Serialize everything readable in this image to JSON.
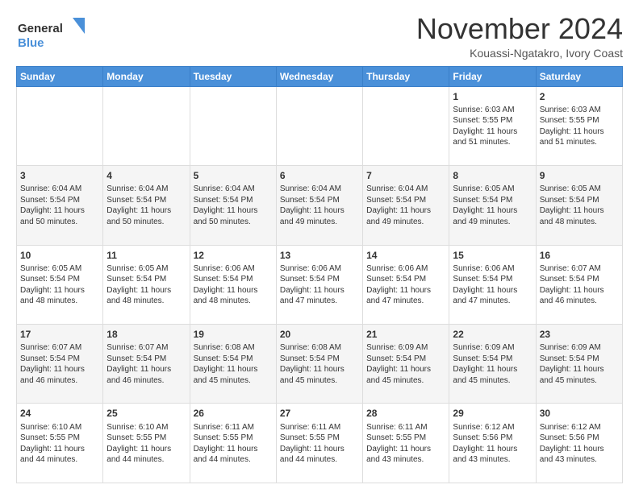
{
  "logo": {
    "line1": "General",
    "line2": "Blue"
  },
  "title": "November 2024",
  "location": "Kouassi-Ngatakro, Ivory Coast",
  "days_of_week": [
    "Sunday",
    "Monday",
    "Tuesday",
    "Wednesday",
    "Thursday",
    "Friday",
    "Saturday"
  ],
  "weeks": [
    [
      {
        "day": "",
        "content": ""
      },
      {
        "day": "",
        "content": ""
      },
      {
        "day": "",
        "content": ""
      },
      {
        "day": "",
        "content": ""
      },
      {
        "day": "",
        "content": ""
      },
      {
        "day": "1",
        "content": "Sunrise: 6:03 AM\nSunset: 5:55 PM\nDaylight: 11 hours\nand 51 minutes."
      },
      {
        "day": "2",
        "content": "Sunrise: 6:03 AM\nSunset: 5:55 PM\nDaylight: 11 hours\nand 51 minutes."
      }
    ],
    [
      {
        "day": "3",
        "content": "Sunrise: 6:04 AM\nSunset: 5:54 PM\nDaylight: 11 hours\nand 50 minutes."
      },
      {
        "day": "4",
        "content": "Sunrise: 6:04 AM\nSunset: 5:54 PM\nDaylight: 11 hours\nand 50 minutes."
      },
      {
        "day": "5",
        "content": "Sunrise: 6:04 AM\nSunset: 5:54 PM\nDaylight: 11 hours\nand 50 minutes."
      },
      {
        "day": "6",
        "content": "Sunrise: 6:04 AM\nSunset: 5:54 PM\nDaylight: 11 hours\nand 49 minutes."
      },
      {
        "day": "7",
        "content": "Sunrise: 6:04 AM\nSunset: 5:54 PM\nDaylight: 11 hours\nand 49 minutes."
      },
      {
        "day": "8",
        "content": "Sunrise: 6:05 AM\nSunset: 5:54 PM\nDaylight: 11 hours\nand 49 minutes."
      },
      {
        "day": "9",
        "content": "Sunrise: 6:05 AM\nSunset: 5:54 PM\nDaylight: 11 hours\nand 48 minutes."
      }
    ],
    [
      {
        "day": "10",
        "content": "Sunrise: 6:05 AM\nSunset: 5:54 PM\nDaylight: 11 hours\nand 48 minutes."
      },
      {
        "day": "11",
        "content": "Sunrise: 6:05 AM\nSunset: 5:54 PM\nDaylight: 11 hours\nand 48 minutes."
      },
      {
        "day": "12",
        "content": "Sunrise: 6:06 AM\nSunset: 5:54 PM\nDaylight: 11 hours\nand 48 minutes."
      },
      {
        "day": "13",
        "content": "Sunrise: 6:06 AM\nSunset: 5:54 PM\nDaylight: 11 hours\nand 47 minutes."
      },
      {
        "day": "14",
        "content": "Sunrise: 6:06 AM\nSunset: 5:54 PM\nDaylight: 11 hours\nand 47 minutes."
      },
      {
        "day": "15",
        "content": "Sunrise: 6:06 AM\nSunset: 5:54 PM\nDaylight: 11 hours\nand 47 minutes."
      },
      {
        "day": "16",
        "content": "Sunrise: 6:07 AM\nSunset: 5:54 PM\nDaylight: 11 hours\nand 46 minutes."
      }
    ],
    [
      {
        "day": "17",
        "content": "Sunrise: 6:07 AM\nSunset: 5:54 PM\nDaylight: 11 hours\nand 46 minutes."
      },
      {
        "day": "18",
        "content": "Sunrise: 6:07 AM\nSunset: 5:54 PM\nDaylight: 11 hours\nand 46 minutes."
      },
      {
        "day": "19",
        "content": "Sunrise: 6:08 AM\nSunset: 5:54 PM\nDaylight: 11 hours\nand 45 minutes."
      },
      {
        "day": "20",
        "content": "Sunrise: 6:08 AM\nSunset: 5:54 PM\nDaylight: 11 hours\nand 45 minutes."
      },
      {
        "day": "21",
        "content": "Sunrise: 6:09 AM\nSunset: 5:54 PM\nDaylight: 11 hours\nand 45 minutes."
      },
      {
        "day": "22",
        "content": "Sunrise: 6:09 AM\nSunset: 5:54 PM\nDaylight: 11 hours\nand 45 minutes."
      },
      {
        "day": "23",
        "content": "Sunrise: 6:09 AM\nSunset: 5:54 PM\nDaylight: 11 hours\nand 45 minutes."
      }
    ],
    [
      {
        "day": "24",
        "content": "Sunrise: 6:10 AM\nSunset: 5:55 PM\nDaylight: 11 hours\nand 44 minutes."
      },
      {
        "day": "25",
        "content": "Sunrise: 6:10 AM\nSunset: 5:55 PM\nDaylight: 11 hours\nand 44 minutes."
      },
      {
        "day": "26",
        "content": "Sunrise: 6:11 AM\nSunset: 5:55 PM\nDaylight: 11 hours\nand 44 minutes."
      },
      {
        "day": "27",
        "content": "Sunrise: 6:11 AM\nSunset: 5:55 PM\nDaylight: 11 hours\nand 44 minutes."
      },
      {
        "day": "28",
        "content": "Sunrise: 6:11 AM\nSunset: 5:55 PM\nDaylight: 11 hours\nand 43 minutes."
      },
      {
        "day": "29",
        "content": "Sunrise: 6:12 AM\nSunset: 5:56 PM\nDaylight: 11 hours\nand 43 minutes."
      },
      {
        "day": "30",
        "content": "Sunrise: 6:12 AM\nSunset: 5:56 PM\nDaylight: 11 hours\nand 43 minutes."
      }
    ]
  ]
}
